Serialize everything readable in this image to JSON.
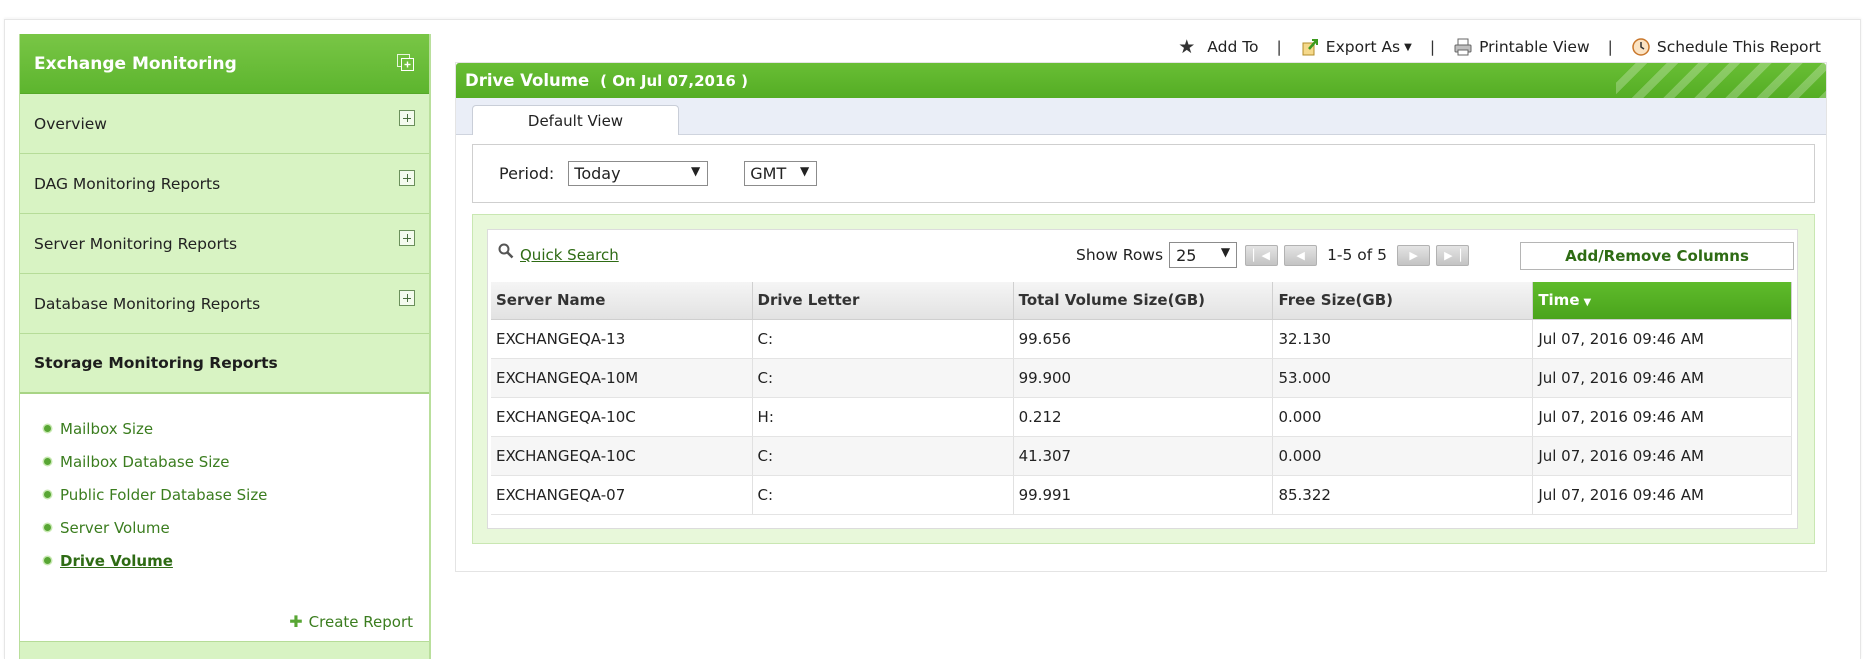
{
  "sidebar": {
    "title": "Exchange Monitoring",
    "items": [
      {
        "label": "Overview"
      },
      {
        "label": "DAG Monitoring Reports"
      },
      {
        "label": "Server Monitoring Reports"
      },
      {
        "label": "Database Monitoring Reports"
      },
      {
        "label": "Storage Monitoring Reports"
      }
    ],
    "sub_items": [
      {
        "label": "Mailbox Size"
      },
      {
        "label": "Mailbox Database Size"
      },
      {
        "label": "Public Folder Database Size"
      },
      {
        "label": "Server Volume"
      },
      {
        "label": "Drive Volume"
      }
    ],
    "create_report": "Create Report"
  },
  "toolbar": {
    "add_to": "Add To",
    "export_as": "Export As",
    "printable_view": "Printable View",
    "schedule": "Schedule This Report",
    "separator": "|"
  },
  "report": {
    "title": "Drive Volume",
    "date": "( On Jul 07,2016 )",
    "tab": "Default View",
    "period_label": "Period:",
    "period_value": "Today",
    "timezone_value": "GMT"
  },
  "grid": {
    "quick_search": "Quick Search",
    "show_rows_label": "Show Rows",
    "rows_value": "25",
    "page_info": "1-5 of 5",
    "add_remove": "Add/Remove Columns",
    "columns": [
      "Server Name",
      "Drive Letter",
      "Total Volume Size(GB)",
      "Free Size(GB)",
      "Time"
    ],
    "rows": [
      [
        "EXCHANGEQA-13",
        "C:",
        "99.656",
        "32.130",
        "Jul 07, 2016 09:46 AM"
      ],
      [
        "EXCHANGEQA-10M",
        "C:",
        "99.900",
        "53.000",
        "Jul 07, 2016 09:46 AM"
      ],
      [
        "EXCHANGEQA-10C",
        "H:",
        "0.212",
        "0.000",
        "Jul 07, 2016 09:46 AM"
      ],
      [
        "EXCHANGEQA-10C",
        "C:",
        "41.307",
        "0.000",
        "Jul 07, 2016 09:46 AM"
      ],
      [
        "EXCHANGEQA-07",
        "C:",
        "99.991",
        "85.322",
        "Jul 07, 2016 09:46 AM"
      ]
    ]
  },
  "colors": {
    "accent_green": "#5db52e",
    "sidebar_bg": "#d8f3c3",
    "link_green": "#3b7d1f"
  }
}
